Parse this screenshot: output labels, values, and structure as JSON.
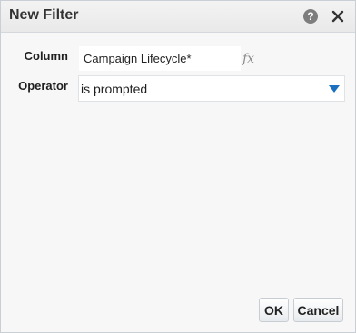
{
  "dialog": {
    "title": "New Filter",
    "help_icon": "help-icon",
    "help_glyph": "?",
    "close_icon": "close-icon"
  },
  "form": {
    "column": {
      "label": "Column",
      "value": "Campaign Lifecycle*",
      "formula_icon": "fx-icon",
      "formula_glyph": "fx"
    },
    "operator": {
      "label": "Operator",
      "selected": "is prompted",
      "arrow_icon": "chevron-down-icon",
      "arrow_color": "#1d6fc0"
    }
  },
  "buttons": {
    "ok_label": "OK",
    "cancel_label": "Cancel"
  }
}
